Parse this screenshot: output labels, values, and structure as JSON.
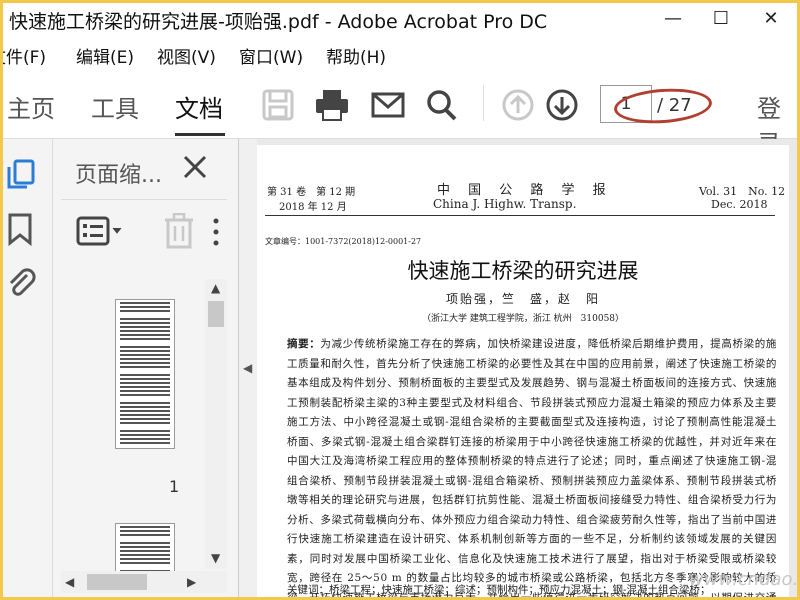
{
  "window": {
    "title": "快速施工桥梁的研究进展-项贻强.pdf - Adobe Acrobat Pro DC",
    "minimize": "—",
    "maximize": "☐",
    "close": "✕"
  },
  "menu": [
    "文件(F)",
    "编辑(E)",
    "视图(V)",
    "窗口(W)",
    "帮助(H)"
  ],
  "toolbar": {
    "tabs": [
      "主页",
      "工具",
      "文档"
    ],
    "active_tab": "文档",
    "page_current": "1",
    "page_total": "/ 27",
    "login": "登录",
    "icons": [
      "save-icon",
      "print-icon",
      "email-icon",
      "search-icon",
      "page-up-icon",
      "page-down-icon"
    ]
  },
  "panel": {
    "title": "页面缩...",
    "thumb_page_number": "1"
  },
  "document": {
    "header_left_1": "第 31 卷　第 12 期",
    "header_left_2": "2018 年 12 月",
    "header_center_1": "中 国 公 路 学 报",
    "header_center_2": "China J. Highw. Transp.",
    "header_right_1": "Vol. 31　No. 12",
    "header_right_2": "Dec. 2018",
    "doc_number": "文章编号：1001-7372(2018)12-0001-27",
    "title": "快速施工桥梁的研究进展",
    "authors": "项贻强，竺　盛，赵　阳",
    "affiliation": "（浙江大学 建筑工程学院，浙江 杭州　310058）",
    "abstract_label": "摘要：",
    "abstract": "为减少传统桥梁施工存在的弊病，加快桥梁建设进度，降低桥梁后期维护费用，提高桥梁的施工质量和耐久性，首先分析了快速施工桥梁的必要性及其在中国的应用前景，阐述了快速施工桥梁的基本组成及构件划分、预制桥面板的主要型式及发展趋势、钢与混凝土桥面板间的连接方式、快速施工预制装配桥梁主梁的3种主要型式及材料组合、节段拼装式预应力混凝土箱梁的预应力体系及主要施工方法、中小跨径混凝土或钢-混组合梁桥的主要截面型式及连接构造，讨论了预制高性能混凝土桥面、多梁式钢-混凝土组合梁群钉连接的桥梁用于中小跨径快速施工桥梁的优越性，并对近年来在中国大江及海湾桥梁工程应用的整体预制桥梁的特点进行了论述；同时，重点阐述了快速施工钢-混组合梁桥、预制节段拼装混凝土或钢-混组合箱梁桥、预制拼装预应力盖梁体系、预制节段拼装式桥墩等相关的理论研究与进展，包括群钉抗剪性能、混凝土桥面板间接缝受力特性、组合梁桥受力行为分析、多梁式荷载横向分布、体外预应力组合梁动力特性、组合梁疲劳耐久性等，指出了当前中国进行快速施工桥梁建造在设计研究、体系机制创新等方面的一些不足，分析制约该领域发展的关键因素，同时对发展中国桥梁工业化、信息化及快速施工技术进行了展望，指出对于桥梁受限或桥梁较宽，跨径在 25～50 m 的数量占比均较多的城市桥梁或公路桥梁，包括北方冬季寒冷影响较大的桥梁，开拓快速施工桥梁与市场潜力巨大，并给出一些值得进一步研究解决的热点问题，以期促进交通行业桥梁基础设施建设技术的进步和创新发展。",
    "keywords": "关键词：桥梁工程；快速施工桥梁；综述；预制构件；预应力混凝土；钢-混凝土组合梁桥；"
  },
  "watermark": "www.cndao.com"
}
